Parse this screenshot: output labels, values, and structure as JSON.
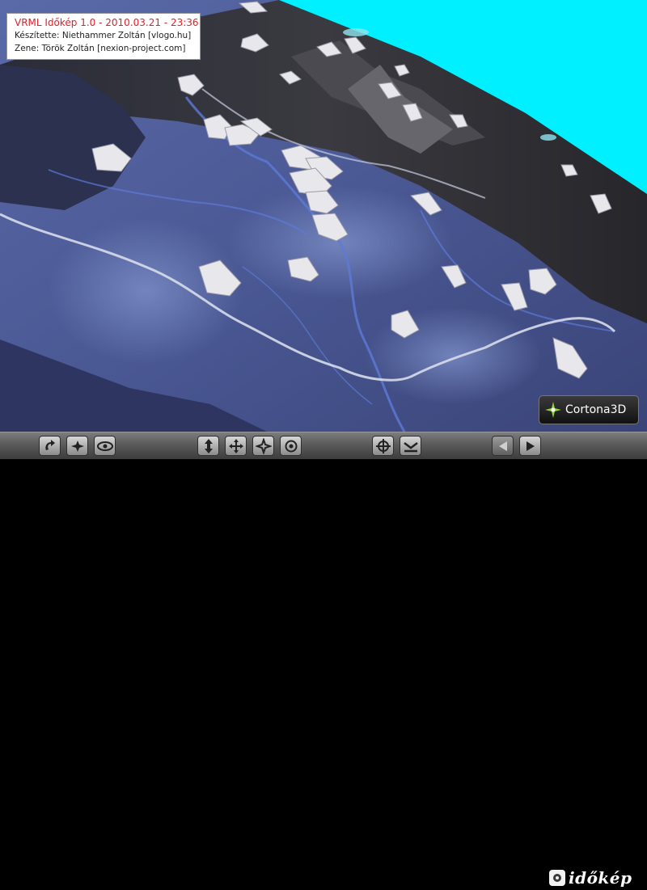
{
  "info": {
    "title": "VRML Időkép  1.0 - 2010.03.21 - 23:36",
    "author": "Készítette: Niethammer Zoltán [vlogo.hu]",
    "music": "Zene: Török Zoltán [nexion-project.com]"
  },
  "badge": {
    "label": "Cortona3D"
  },
  "logo": {
    "text": "időkép"
  },
  "colors": {
    "sky": "#00f0ff",
    "plain": "#4a5a99",
    "mountain": "#2f2f33",
    "title_red": "#e0202a"
  },
  "toolbar": {
    "groups": [
      [
        "study-icon",
        "fly-icon",
        "view-eye-icon"
      ],
      [
        "pan-vertical-icon",
        "pan-cross-icon",
        "tilt-icon",
        "rotate-icon"
      ],
      [
        "fit-target-icon",
        "restore-view-icon"
      ],
      [
        "previous-viewpoint-icon",
        "next-viewpoint-icon"
      ]
    ]
  }
}
